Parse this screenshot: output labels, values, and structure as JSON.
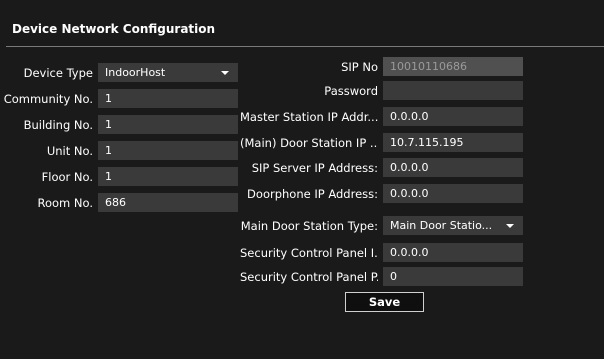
{
  "title": "Device Network Configuration",
  "left": {
    "device_type": {
      "label": "Device Type",
      "value": "IndoorHost"
    },
    "community_no": {
      "label": "Community No.",
      "value": "1"
    },
    "building_no": {
      "label": "Building No.",
      "value": "1"
    },
    "unit_no": {
      "label": "Unit No.",
      "value": "1"
    },
    "floor_no": {
      "label": "Floor No.",
      "value": "1"
    },
    "room_no": {
      "label": "Room No.",
      "value": "686"
    }
  },
  "right": {
    "sip_no": {
      "label": "SIP No",
      "value": "10010110686"
    },
    "password": {
      "label": "Password",
      "value": ""
    },
    "master_station_ip": {
      "label": "Master Station IP Addr...",
      "value": "0.0.0.0"
    },
    "main_door_station_ip": {
      "label": "(Main) Door Station IP ...",
      "value": "10.7.115.195"
    },
    "sip_server_ip": {
      "label": "SIP Server IP Address:",
      "value": "0.0.0.0"
    },
    "doorphone_ip": {
      "label": "Doorphone IP Address:",
      "value": "0.0.0.0"
    },
    "main_door_station_type": {
      "label": "Main Door Station Type:",
      "value": "Main Door Statio..."
    },
    "security_panel_ip": {
      "label": "Security Control Panel I...",
      "value": "0.0.0.0"
    },
    "security_panel_port": {
      "label": "Security Control Panel P...",
      "value": "0"
    }
  },
  "save_label": "Save"
}
